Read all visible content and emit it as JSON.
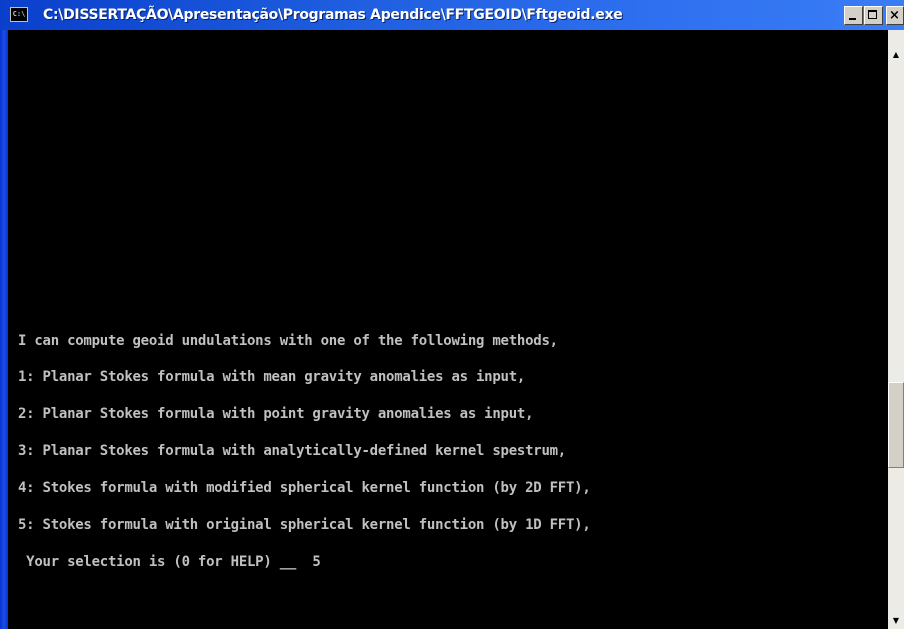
{
  "window": {
    "title": "C:\\DISSERTAÇÃO\\Apresentação\\Programas Apendice\\FFTGEOID\\Fftgeoid.exe",
    "icon": "console-icon",
    "icon_text": "C:\\",
    "controls": {
      "minimize_icon": "minimize-icon",
      "maximize_icon": "maximize-icon",
      "close_icon": "close-icon",
      "close_glyph": "×"
    }
  },
  "console": {
    "background": "#000000",
    "text_color": "#c0c0c0",
    "lines": [
      "I can compute geoid undulations with one of the following methods,",
      "1: Planar Stokes formula with mean gravity anomalies as input,",
      "2: Planar Stokes formula with point gravity anomalies as input,",
      "3: Planar Stokes formula with analytically-defined kernel spestrum,",
      "4: Stokes formula with modified spherical kernel function (by 2D FFT),",
      "5: Stokes formula with original spherical kernel function (by 1D FFT),",
      " Your selection is (0 for HELP) __  5"
    ]
  },
  "scrollbar": {
    "up_glyph": "▲",
    "down_glyph": "▼"
  }
}
